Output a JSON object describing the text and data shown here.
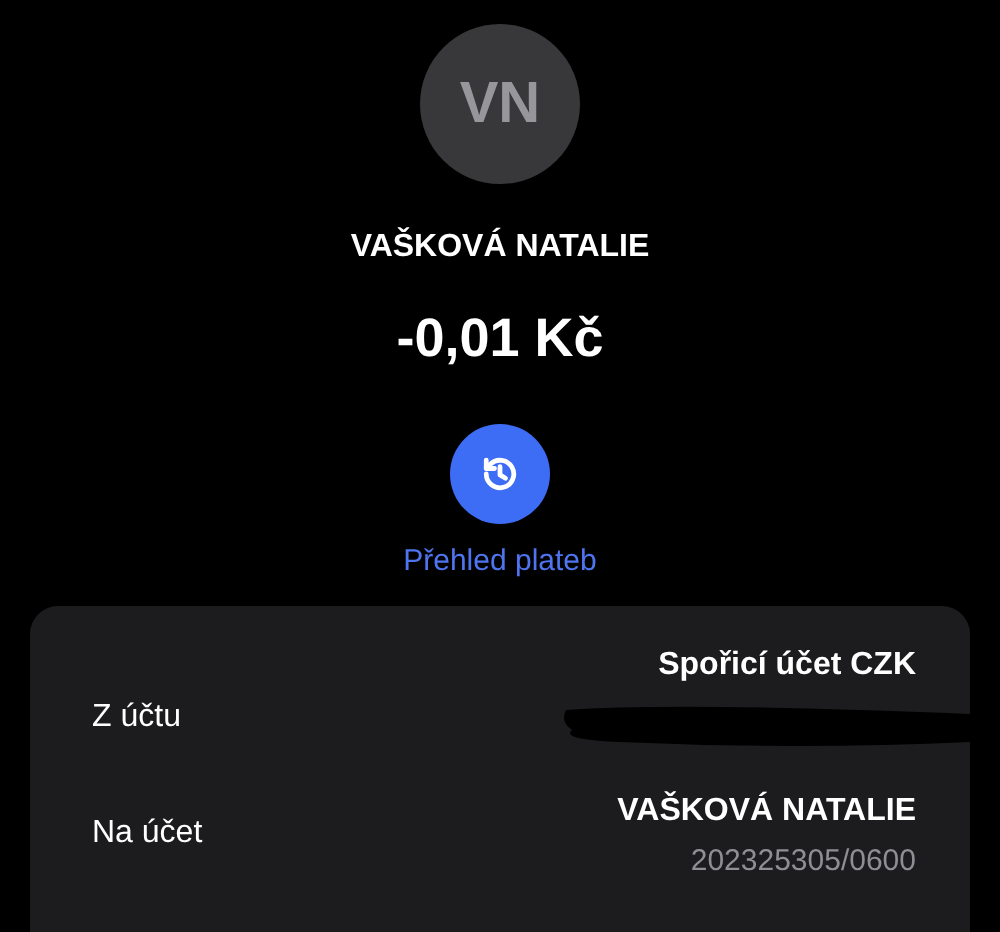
{
  "contact": {
    "initials": "VN",
    "name": "VAŠKOVÁ NATALIE",
    "amount": "-0,01 Kč"
  },
  "history_button": {
    "label": "Přehled plateb"
  },
  "details": [
    {
      "label": "Z účtu",
      "value": "Spořicí účet CZK",
      "redacted": true
    },
    {
      "label": "Na účet",
      "value": "VAŠKOVÁ NATALIE",
      "subvalue": "202325305/0600",
      "redacted": false
    }
  ]
}
